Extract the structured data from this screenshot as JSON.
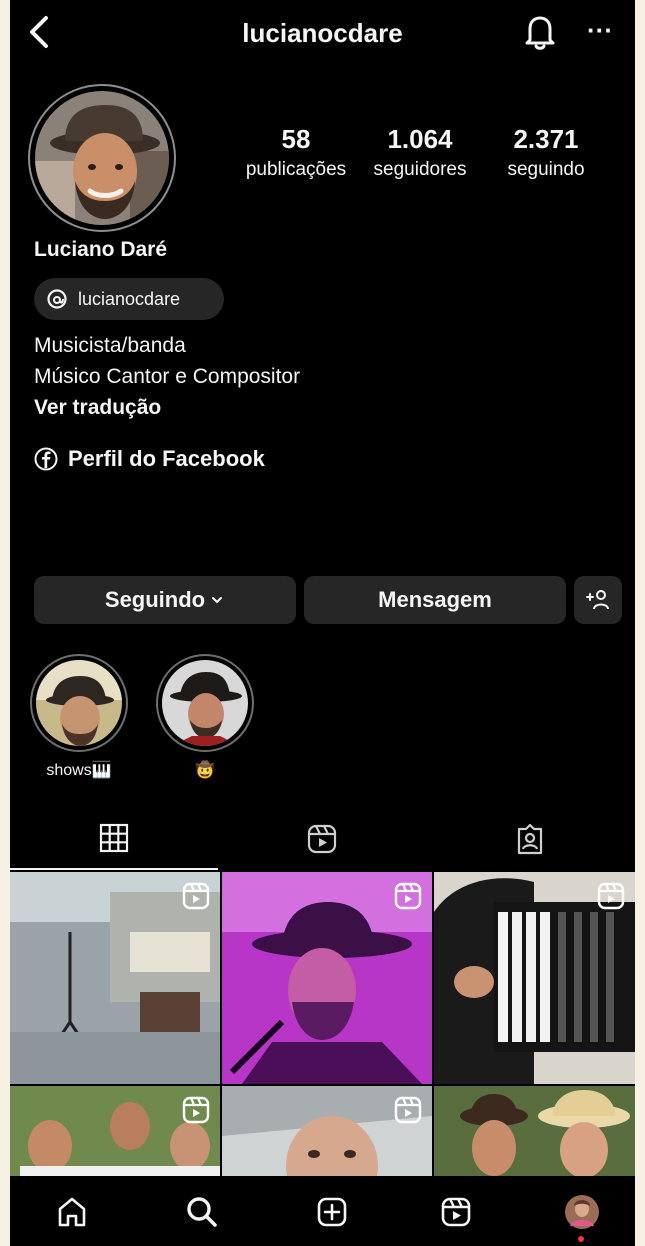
{
  "header": {
    "username": "lucianocdare",
    "more_label": "···"
  },
  "profile": {
    "display_name": "Luciano Daré",
    "stats": [
      {
        "value": "58",
        "label": "publicações"
      },
      {
        "value": "1.064",
        "label": "seguidores"
      },
      {
        "value": "2.371",
        "label": "seguindo"
      }
    ],
    "threads_handle": "lucianocdare",
    "bio_lines": [
      "Musicista/banda",
      "Músico Cantor e Compositor"
    ],
    "translate_label": "Ver tradução",
    "facebook_link": "Perfil do Facebook"
  },
  "actions": {
    "following_label": "Seguindo",
    "message_label": "Mensagem",
    "add_user_label": "+👤"
  },
  "highlights": [
    {
      "label": "shows🎹"
    },
    {
      "label": "🤠"
    }
  ],
  "tabs": [
    "grid-icon",
    "reels-icon",
    "tagged-icon"
  ],
  "bottom_nav": [
    "home-icon",
    "search-icon",
    "create-icon",
    "reels-icon",
    "profile-avatar"
  ],
  "colors": {
    "background": "#000000",
    "button_bg": "#262626",
    "text": "#f5f5f5",
    "notification_dot": "#ff3040"
  }
}
